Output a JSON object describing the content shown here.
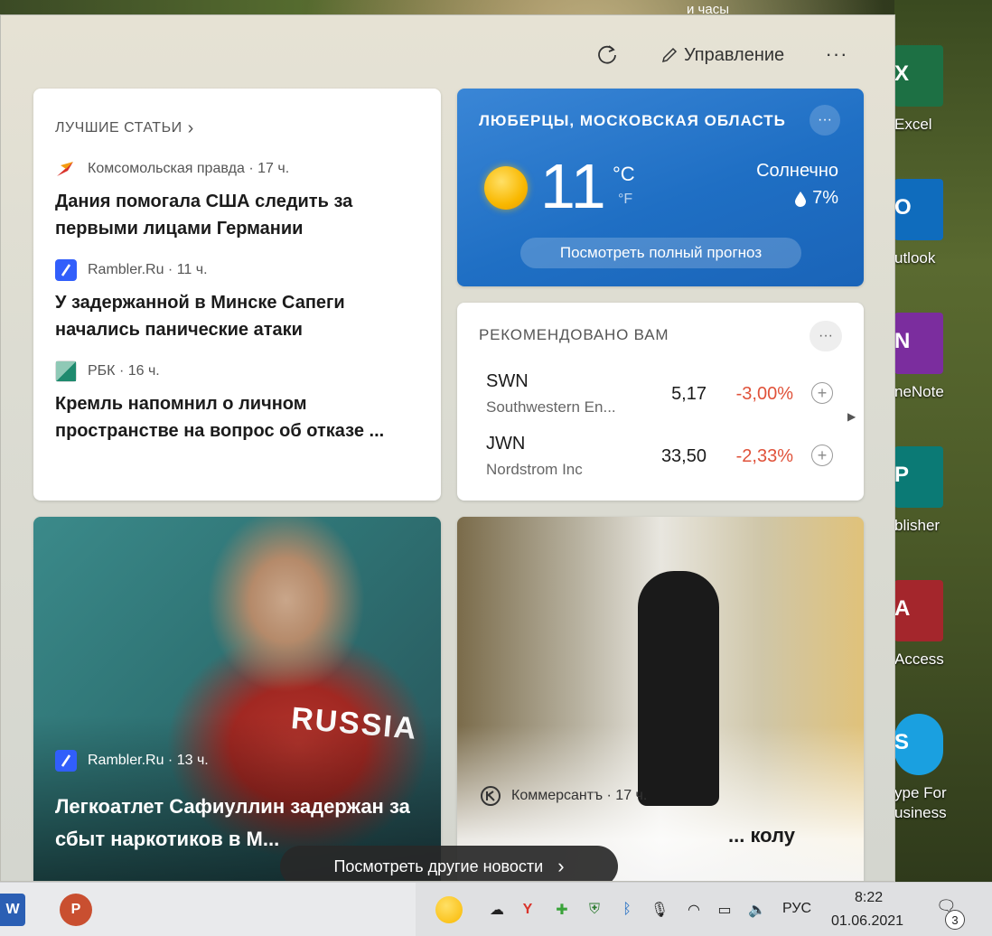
{
  "desktop": {
    "top_text": "и часы",
    "icons": [
      {
        "letter": "X",
        "label": "Excel",
        "color": "#1d7044"
      },
      {
        "letter": "O",
        "label": "utlook",
        "color": "#0f6cbd"
      },
      {
        "letter": "N",
        "label": "neNote",
        "color": "#7b2d9e"
      },
      {
        "letter": "P",
        "label": "blisher",
        "color": "#0b7a75"
      },
      {
        "letter": "A",
        "label": "Access",
        "color": "#a4262c"
      },
      {
        "letter": "S",
        "label": "ype For",
        "label2": "usiness",
        "color": "#1aa0e0"
      }
    ]
  },
  "panel": {
    "refresh_icon": "refresh-icon",
    "manage_label": "Управление",
    "more_icon": "···"
  },
  "top_stories": {
    "heading": "ЛУЧШИЕ СТАТЬИ",
    "chevron": "›",
    "items": [
      {
        "source": "Комсомольская правда · 17 ч.",
        "logo_color": "#d9342b",
        "title": "Дания помогала США следить за первыми лицами Германии"
      },
      {
        "source": "Rambler.Ru · 11 ч.",
        "logo_color": "#315efb",
        "title": "У задержанной в Минске Сапеги начались панические атаки"
      },
      {
        "source": "РБК · 16 ч.",
        "logo_color": "#1e8a6e",
        "title": "Кремль напомнил о личном пространстве на вопрос об отказе ..."
      }
    ]
  },
  "weather": {
    "location": "ЛЮБЕРЦЫ, МОСКОВСКАЯ ОБЛАСТЬ",
    "temp": "11",
    "unit_c": "°C",
    "unit_f": "°F",
    "condition": "Солнечно",
    "precip": "7%",
    "forecast_button": "Посмотреть полный прогноз",
    "more": "···"
  },
  "stocks": {
    "heading": "РЕКОМЕНДОВАНО ВАМ",
    "more": "···",
    "rows": [
      {
        "symbol": "SWN",
        "name": "Southwestern En...",
        "price": "5,17",
        "change": "-3,00%"
      },
      {
        "symbol": "JWN",
        "name": "Nordstrom Inc",
        "price": "33,50",
        "change": "-2,33%"
      }
    ]
  },
  "news_cards": {
    "athlete": {
      "shirt": "RUSSIA",
      "source": "Rambler.Ru · 13 ч.",
      "title": "Легкоатлет Сафиуллин задержан за сбыт наркотиков в М..."
    },
    "school": {
      "source": "Коммерсантъ · 17 ч.",
      "title": "... колу"
    }
  },
  "more_news_button": "Посмотреть другие новости",
  "taskbar": {
    "lang": "РУС",
    "time": "8:22",
    "date": "01.06.2021",
    "notifications": "3"
  }
}
